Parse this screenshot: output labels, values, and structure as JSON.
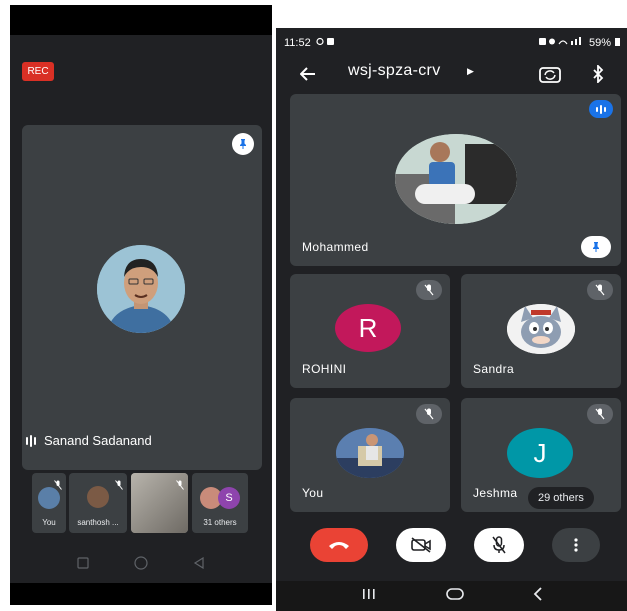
{
  "left": {
    "rec_label": "REC",
    "speaker_name": "Sanand Sadanand",
    "thumbnails": [
      {
        "label": "You"
      },
      {
        "label": "santhosh ..."
      },
      {
        "label": ""
      },
      {
        "label": "31 others",
        "letter": "S"
      }
    ]
  },
  "right": {
    "status": {
      "time": "11:52",
      "battery": "59%"
    },
    "meeting_code": "wsj-spza-crv",
    "tiles": [
      {
        "name": "Mohammed"
      },
      {
        "name": "ROHINI",
        "letter": "R",
        "color": "#c2185b"
      },
      {
        "name": "Sandra"
      },
      {
        "name": "You"
      },
      {
        "name": "Jeshma",
        "letter": "J",
        "color": "#0097a7"
      }
    ],
    "others_label": "29 others"
  },
  "colors": {
    "background": "#202124",
    "tile": "#3c4043",
    "end_call": "#ea4335",
    "rec": "#d93025",
    "accent_blue": "#1a73e8"
  }
}
